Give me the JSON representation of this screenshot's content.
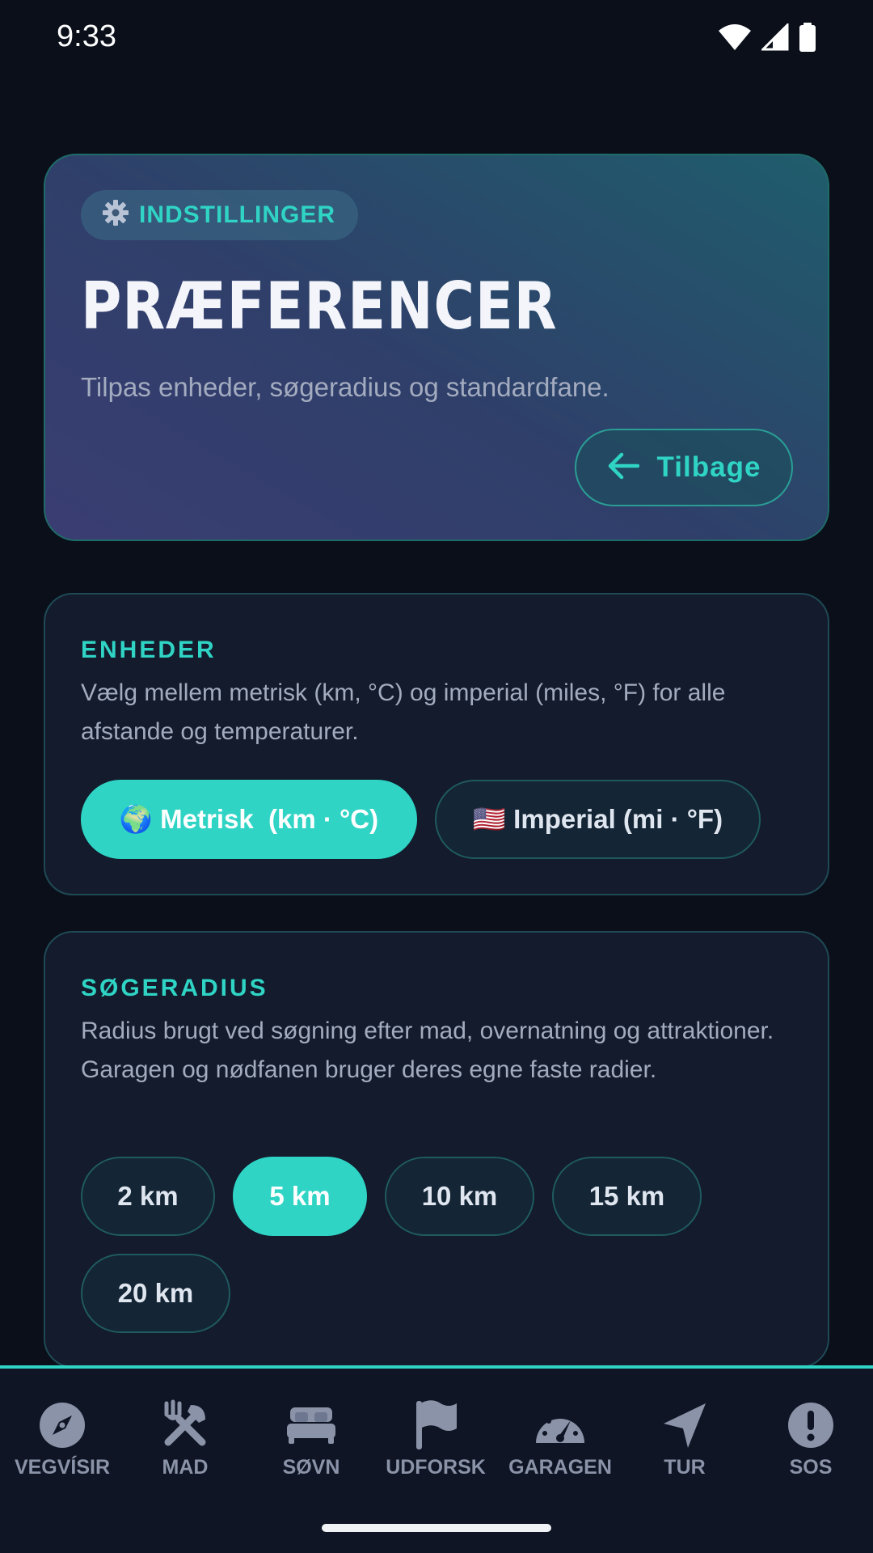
{
  "status_bar": {
    "time": "9:33"
  },
  "header": {
    "badge_label": "INDSTILLINGER",
    "badge_icon": "gear-icon",
    "title": "PRÆFERENCER",
    "subtitle": "Tilpas enheder, søgeradius og standardfane.",
    "back_label": "Tilbage"
  },
  "units": {
    "heading": "ENHEDER",
    "description": "Vælg mellem metrisk (km, °C) og imperial (miles, °F) for alle afstande og temperaturer.",
    "options": [
      {
        "label": "🌍 Metrisk  (km · °C)",
        "selected": true
      },
      {
        "label": "🇺🇸 Imperial (mi · °F)",
        "selected": false
      }
    ]
  },
  "radius": {
    "heading": "SØGERADIUS",
    "description": "Radius brugt ved søgning efter mad, overnatning og attraktioner. Garagen og nødfanen bruger deres egne faste radier.",
    "options": [
      {
        "label": "2 km",
        "selected": false
      },
      {
        "label": "5 km",
        "selected": true
      },
      {
        "label": "10 km",
        "selected": false
      },
      {
        "label": "15 km",
        "selected": false
      },
      {
        "label": "20 km",
        "selected": false
      }
    ]
  },
  "nav": {
    "items": [
      {
        "label": "VEGVÍSIR",
        "icon": "compass-icon"
      },
      {
        "label": "MAD",
        "icon": "utensils-icon"
      },
      {
        "label": "SØVN",
        "icon": "bed-icon"
      },
      {
        "label": "UDFORSK",
        "icon": "flag-icon"
      },
      {
        "label": "GARAGEN",
        "icon": "speedometer-icon"
      },
      {
        "label": "TUR",
        "icon": "navigation-arrow-icon"
      },
      {
        "label": "SOS",
        "icon": "alert-icon"
      }
    ]
  },
  "colors": {
    "accent": "#2fd4c5",
    "background": "#0a0f1a",
    "card": "#131b2c",
    "muted_text": "#a3abbf"
  }
}
